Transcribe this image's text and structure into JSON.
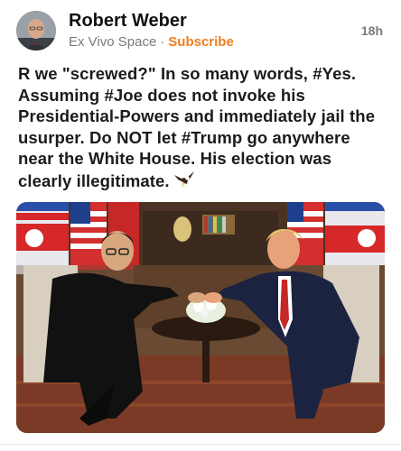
{
  "post": {
    "author_name": "Robert Weber",
    "publication": "Ex Vivo Space",
    "separator": "·",
    "subscribe_label": "Subscribe",
    "timestamp": "18h",
    "body_lines": [
      "R we \"screwed?\" In so many words, #Yes.",
      "Assuming #Joe does not invoke his",
      "Presidential-Powers and immediately jail the",
      "usurper. Do NOT let #Trump go anywhere",
      "near the White House. His election was",
      "clearly illegitimate."
    ],
    "emoji": "eagle-icon"
  },
  "colors": {
    "subscribe_accent": "#f07d1c",
    "meta_gray": "#7a7a7a"
  }
}
